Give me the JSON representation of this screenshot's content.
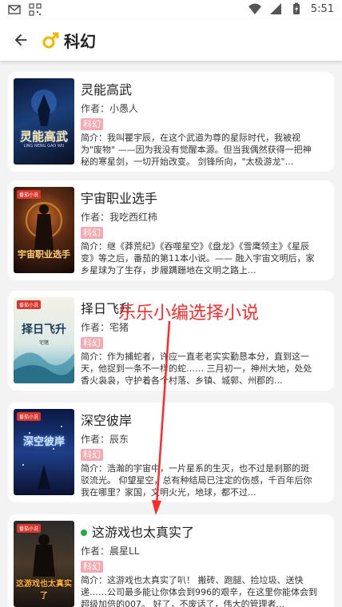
{
  "status_bar": {
    "time": "5:51"
  },
  "app_bar": {
    "title": "科幻",
    "back_icon": "arrow-back-icon",
    "gender_icon": "male-symbol-icon",
    "accent": "#f5b400"
  },
  "annotation": {
    "text": "乐乐小编选择小说",
    "color": "#ff2a2a"
  },
  "books": [
    {
      "title": "灵能高武",
      "author_label": "作者：",
      "author": "小愚人",
      "tag": "科幻",
      "intro_label": "简介：",
      "desc": "我叫瞿宇辰，在这个武道为尊的星际时代，我被视为\"废物\" ——因为我没有觉醒本源。但当我偶然获得一把神秘的寒星剑，一切开始改变。 剑锋所向，\"太极游龙\"...",
      "cover_title": "灵能高武",
      "cover_sub": "LING NENG GAO WU",
      "cover_badge": ""
    },
    {
      "title": "宇宙职业选手",
      "author_label": "作者：",
      "author": "我吃西红柿",
      "tag": "科幻",
      "intro_label": "简介：",
      "desc": "继《莽荒纪》《吞噬星空》《盘龙》《雪鹰领主》《星辰变》等之后，番茄的第11本小说。—— 融入宇宙文明后，家乡星球为了生存，步履蹒跚地在文明之路上...",
      "cover_title": "宇宙职业选手",
      "cover_sub": "",
      "cover_badge": "番茄小说"
    },
    {
      "title": "择日飞升",
      "author_label": "作者：",
      "author": "宅猪",
      "tag": "科幻",
      "intro_label": "简介：",
      "desc": "作为捕蛇者，许应一直老老实实勤恳本分，直到这一天，他捉到一条不一样的蛇…… 三月初一，神州大地，处处香火袅袅，守护着各个村落、乡镇、城郭、州郡的...",
      "cover_title": "择日飞升",
      "cover_sub": "宅猪",
      "cover_badge": "番茄小说"
    },
    {
      "title": "深空彼岸",
      "author_label": "作者：",
      "author": "辰东",
      "tag": "科幻",
      "intro_label": "简介：",
      "desc": "浩瀚的宇宙中，一片星系的生灭，也不过是刹那的斑驳流光。 仰望星空，总有种结局已注定的伤感，千百年后你我在哪里？家国，文明火光，地球，都不过...",
      "cover_title": "深空彼岸",
      "cover_sub": "",
      "cover_badge": "番茄小说"
    },
    {
      "title": "这游戏也太真实了",
      "author_label": "作者：",
      "author": "晨星LL",
      "tag": "科幻",
      "intro_label": "简介：",
      "desc": "这游戏也太真实了叭！ 搬砖、跑腿、捡垃圾、送快递……公司最多能让你体会到996的艰辛，在这里你能体会到超级加倍的007。 好了，不废话了，伟大的管理者...",
      "cover_title": "这游戏也太真实了",
      "cover_sub": "",
      "cover_badge": "番茄小说"
    }
  ]
}
